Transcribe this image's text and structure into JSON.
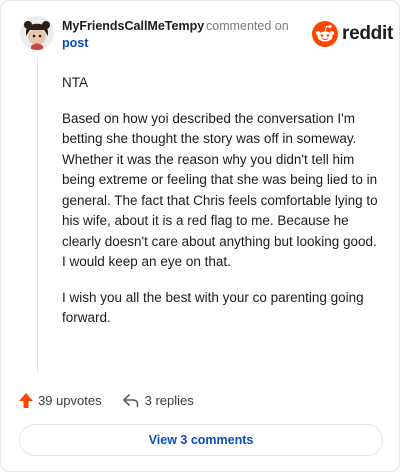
{
  "comment": {
    "author": "MyFriendsCallMeTempy",
    "action_text": "commented on",
    "target_link": "post",
    "brand": "reddit",
    "paragraphs": [
      "NTA",
      "Based on how yoi described the conversation I'm betting she thought the story was off in someway. Whether it was the reason why you didn't tell him being extreme or feeling that she was being lied to in general. The fact that Chris feels comfortable lying to his wife, about it is a red flag to me. Because he clearly doesn't care about anything but looking good. I would keep an eye on that.",
      "I wish you all the best with your co parenting going forward."
    ],
    "upvotes_label": "39 upvotes",
    "replies_label": "3 replies",
    "view_comments_label": "View 3 comments"
  },
  "colors": {
    "upvote_arrow": "#ff4500",
    "link_blue": "#0b4dbf",
    "reddit_orange": "#ff4500"
  },
  "icons": {
    "avatar": "snoo-avatar-icon",
    "logo": "reddit-logo-icon",
    "upvote": "upvote-arrow-icon",
    "reply": "reply-arrow-icon"
  }
}
